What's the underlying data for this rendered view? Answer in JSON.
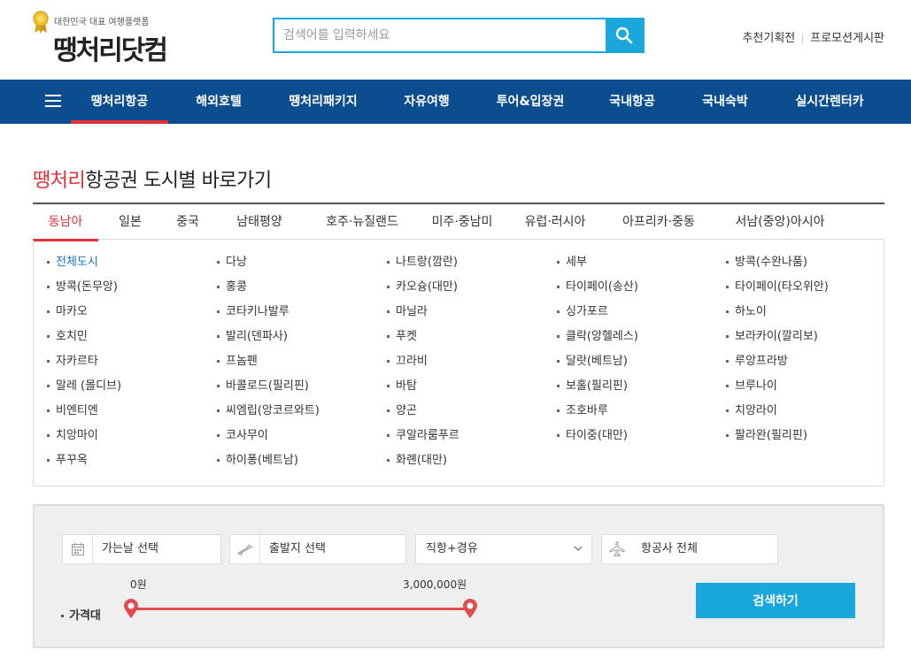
{
  "header": {
    "tagline": "대한민국 대표 여행플랫폼",
    "logo_text": "땡처리닷컴",
    "search_placeholder": "검색어를 입력하세요",
    "links": [
      "추천기획전",
      "프로모션게시판"
    ]
  },
  "nav": {
    "items": [
      "땡처리항공",
      "해외호텔",
      "땡처리패키지",
      "자유여행",
      "투어&입장권",
      "국내항공",
      "국내숙박",
      "실시간렌터카"
    ],
    "active_index": 0
  },
  "section": {
    "title_highlight": "땡처리",
    "title_rest": "항공권 도시별 바로가기"
  },
  "region_tabs": {
    "items": [
      "동남아",
      "일본",
      "중국",
      "남태평양",
      "호주·뉴질랜드",
      "미주·중남미",
      "유럽·러시아",
      "아프리카·중동",
      "서남(중앙)아시아"
    ],
    "active_index": 0
  },
  "cities": [
    "전체도시",
    "다낭",
    "나트랑(깜란)",
    "세부",
    "방콕(수완나품)",
    "방콕(돈무앙)",
    "홍콩",
    "카오슝(대만)",
    "타이페이(송산)",
    "타이페이(타오위안)",
    "마카오",
    "코타키나발루",
    "마닐라",
    "싱가포르",
    "하노이",
    "호치민",
    "발리(덴파사)",
    "푸켓",
    "클락(앙헬레스)",
    "보라카이(깔리보)",
    "자카르타",
    "프놈펜",
    "끄라비",
    "달랏(베트남)",
    "루앙프라방",
    "말레 (몰디브)",
    "바콜로드(필리핀)",
    "바탐",
    "보홀(필리핀)",
    "브루나이",
    "비엔티엔",
    "씨엠립(앙코르와트)",
    "양곤",
    "조호바루",
    "치앙라이",
    "치앙마이",
    "코사무이",
    "쿠알라룸푸르",
    "타이중(대만)",
    "팔라완(필리핀)",
    "푸꾸옥",
    "하이퐁(베트남)",
    "화롄(대만)"
  ],
  "search_panel": {
    "date": "가는날 선택",
    "departure": "출발지 선택",
    "route": "직항+경유",
    "airline": "항공사 전체",
    "price_min": "0원",
    "price_max": "3,000,000원",
    "price_label": "가격대",
    "submit": "검색하기"
  },
  "colors": {
    "brand_blue": "#0b4d8f",
    "accent_red": "#e0303a",
    "search_blue": "#1aa8dc"
  }
}
